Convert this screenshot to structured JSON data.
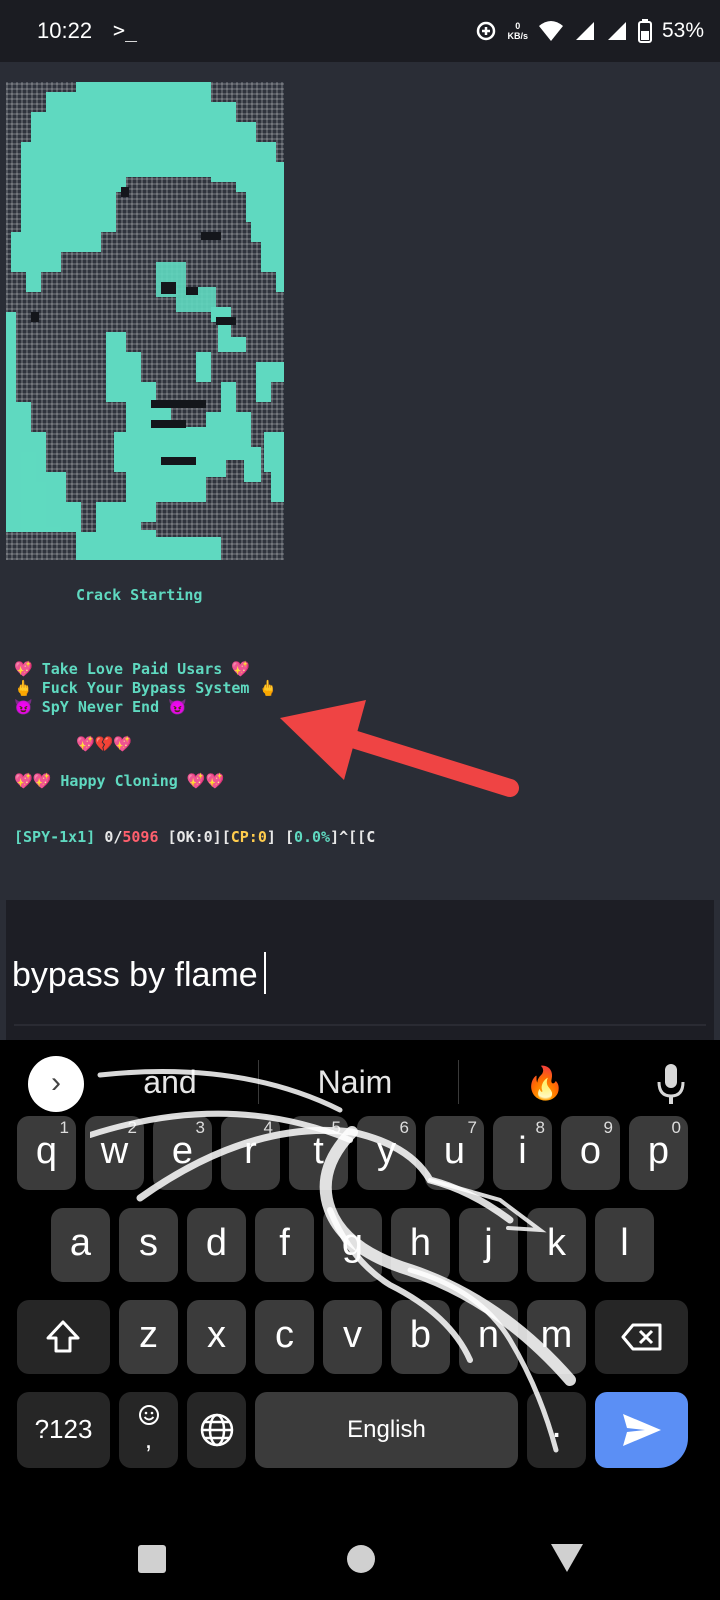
{
  "status_bar": {
    "time": "10:22",
    "terminal_icon": ">_",
    "net_speed_value": "0",
    "net_speed_unit": "KB/s",
    "battery": "53%"
  },
  "terminal": {
    "art": "teal-ascii-portrait",
    "crack_starting": "Crack Starting",
    "msg1": "💖 Take Love Paid Usars 💖",
    "msg2": "🖕 Fuck Your Bypass System 🖕",
    "msg3": "😈 SpY Never End 😈",
    "hearts": "💖💔💖",
    "happy_cloning": "💖💖 Happy Cloning 💖💖",
    "progress": {
      "tag": "[SPY-1x1]",
      "count": "0/",
      "total": "5096",
      "ok_label": "[OK:0]",
      "cp_open": "[",
      "cp_label": "CP:0",
      "cp_close": "]",
      "pct_open": "[",
      "pct_value": "0.0%",
      "pct_close": "]^[[C"
    }
  },
  "input": {
    "value": "bypass by flame"
  },
  "keyboard": {
    "suggest_toggle": "›",
    "suggestions": [
      "and",
      "Naim",
      "🔥"
    ],
    "row1": [
      {
        "k": "q",
        "s": "1"
      },
      {
        "k": "w",
        "s": "2"
      },
      {
        "k": "e",
        "s": "3"
      },
      {
        "k": "r",
        "s": "4"
      },
      {
        "k": "t",
        "s": "5"
      },
      {
        "k": "y",
        "s": "6"
      },
      {
        "k": "u",
        "s": "7"
      },
      {
        "k": "i",
        "s": "8"
      },
      {
        "k": "o",
        "s": "9"
      },
      {
        "k": "p",
        "s": "0"
      }
    ],
    "row2": [
      "a",
      "s",
      "d",
      "f",
      "g",
      "h",
      "j",
      "k",
      "l"
    ],
    "row3": [
      "z",
      "x",
      "c",
      "v",
      "b",
      "n",
      "m"
    ],
    "numbers_key": "?123",
    "comma_key": ",",
    "space_key": "English",
    "period_key": ".",
    "accent_color": "#5b8ff5",
    "icons": [
      "shift-icon",
      "backspace-icon",
      "emoji-icon",
      "globe-icon",
      "send-icon",
      "mic-icon"
    ]
  },
  "colors": {
    "terminal_bg": "#2a2d36",
    "teal": "#5fd9c0",
    "arrow": "#ef4444"
  }
}
